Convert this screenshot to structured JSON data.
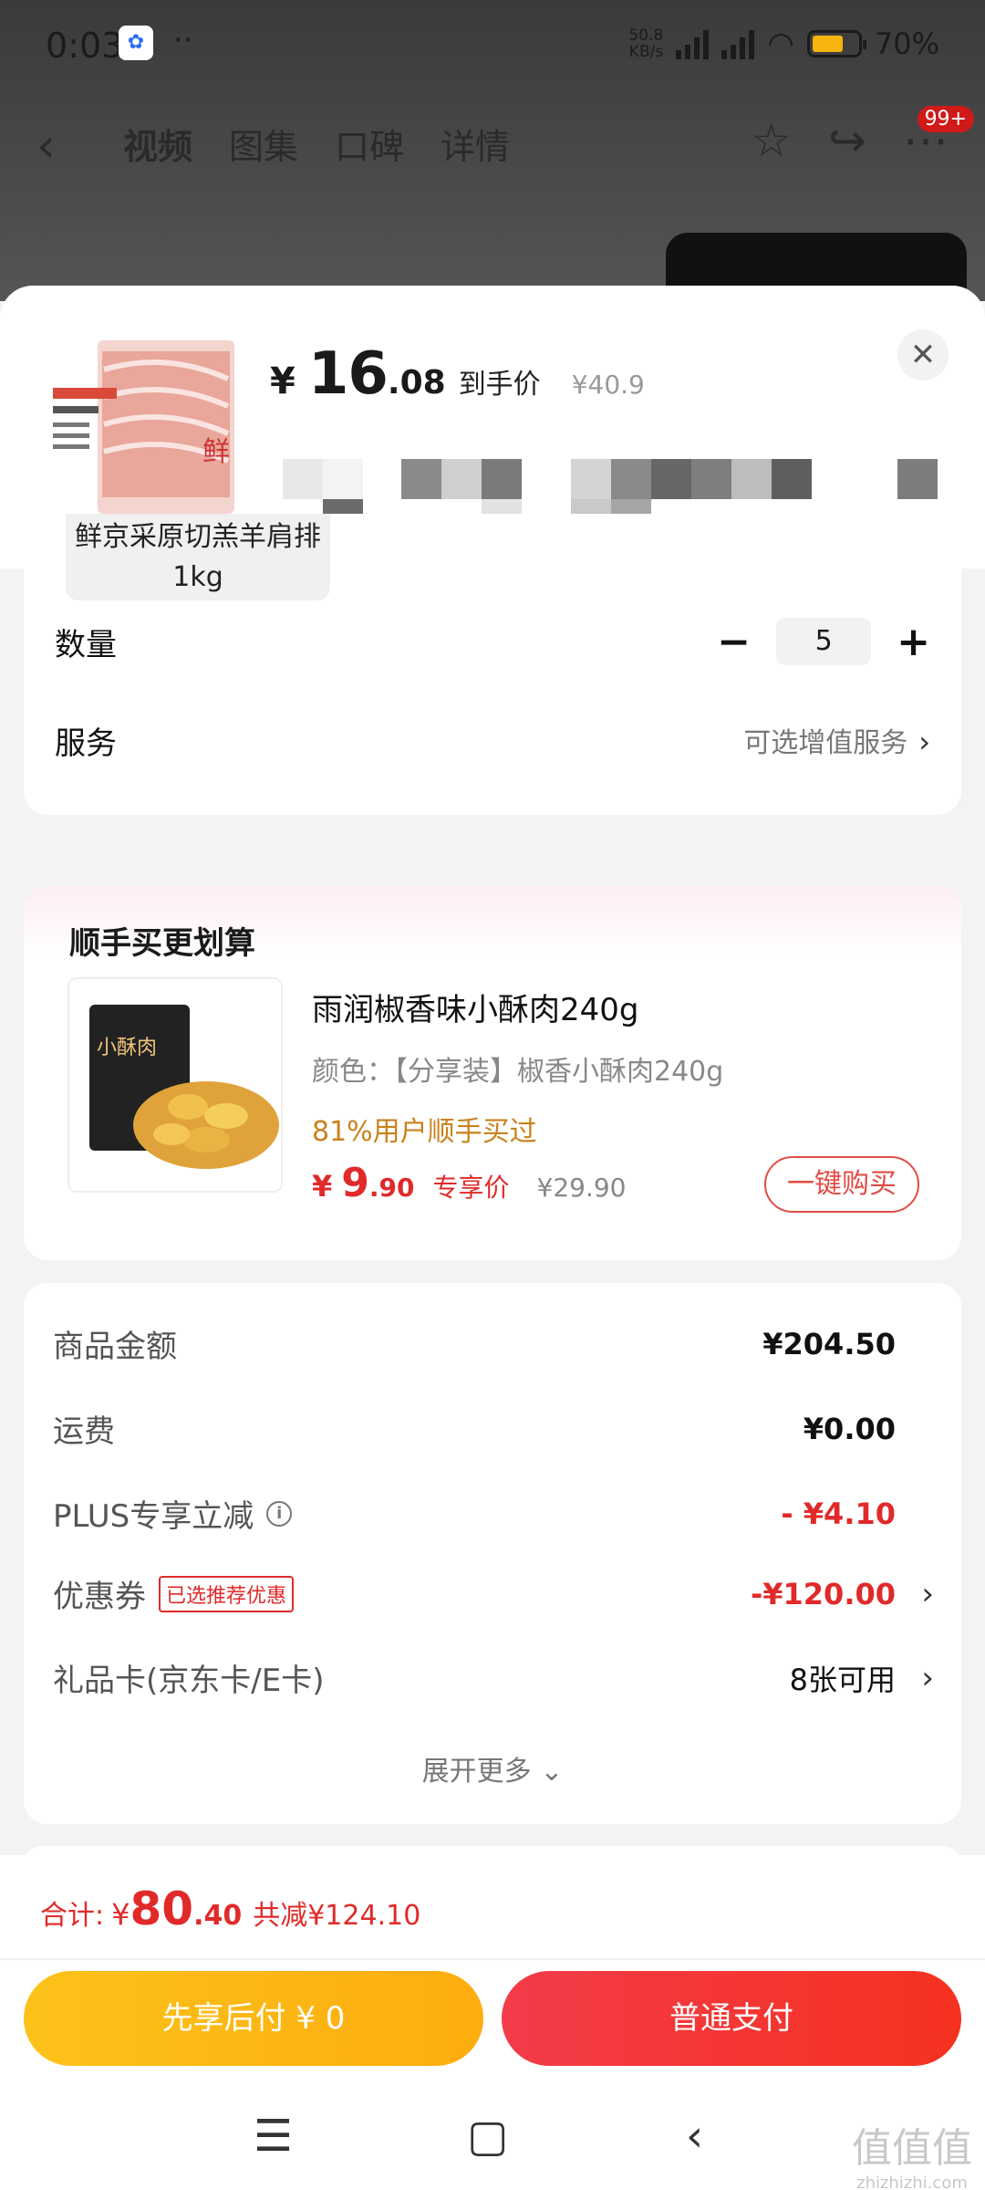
{
  "status_bar": {
    "time": "0:03",
    "net_speed_value": "50.8",
    "net_speed_unit": "KB/s",
    "battery": "70%",
    "battery_level": 0.7
  },
  "nav": {
    "tabs": [
      "视频",
      "图集",
      "口碑",
      "详情"
    ],
    "badge": "99+"
  },
  "product": {
    "price_currency": "¥",
    "price_int": "16",
    "price_dec": ".08",
    "price_label": "到手价",
    "original_price": "¥40.9",
    "sku_chip": "鲜京采原切羔羊肩排 1kg"
  },
  "quantity": {
    "label": "数量",
    "value": "5",
    "minus": "−",
    "plus": "+"
  },
  "service": {
    "label": "服务",
    "value": "可选增值服务"
  },
  "upsell": {
    "title": "顺手买更划算",
    "name": "雨润椒香味小酥肉240g",
    "spec": "颜色：【分享装】椒香小酥肉240g",
    "rate": "81%用户顺手买过",
    "price_currency": "¥",
    "price_int": "9",
    "price_dec": ".90",
    "price_label": "专享价",
    "original_price": "¥29.90",
    "buy_label": "一键购买",
    "package_label": "小酥肉"
  },
  "summary": {
    "rows": [
      {
        "label": "商品金额",
        "value": "¥204.50"
      },
      {
        "label": "运费",
        "value": "¥0.00"
      },
      {
        "label": "PLUS专享立减",
        "value": "- ¥4.10"
      },
      {
        "label": "优惠券",
        "tag": "已选推荐优惠",
        "value": "-¥120.00"
      },
      {
        "label": "礼品卡(京东卡/E卡)",
        "value": "8张可用"
      }
    ],
    "more": "展开更多"
  },
  "bottom": {
    "total_label": "合计:",
    "total_currency": "¥",
    "total_int": "80",
    "total_dec": ".40",
    "saved": "共减¥124.10",
    "pay_later": "先享后付 ¥ 0",
    "pay_normal": "普通支付"
  },
  "watermark": {
    "text": "值值值",
    "url": "zhizhizhi.com"
  },
  "colors": {
    "accent_red": "#e02a2a",
    "pay_later": "#fcc21a",
    "pay_normal": "#f43b4a"
  }
}
